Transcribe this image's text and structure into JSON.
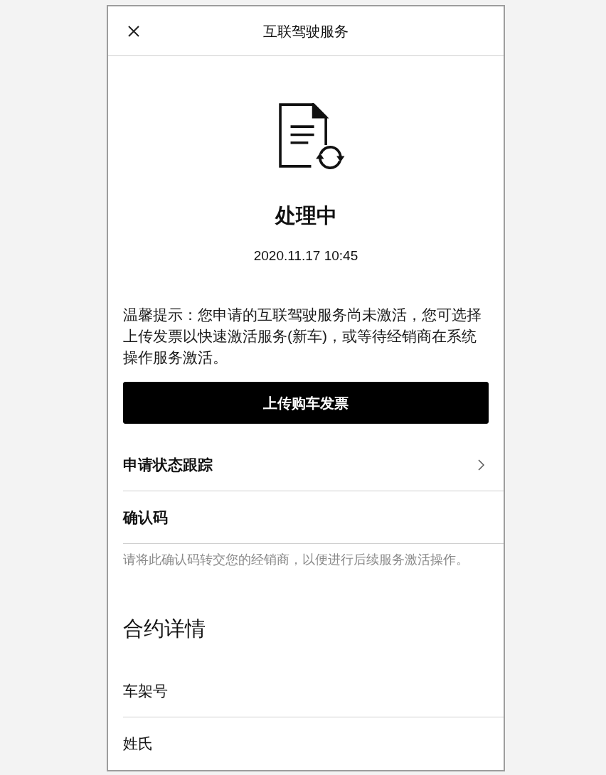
{
  "header": {
    "title": "互联驾驶服务"
  },
  "status": {
    "title": "处理中",
    "timestamp": "2020.11.17 10:45",
    "notice": "温馨提示：您申请的互联驾驶服务尚未激活，您可选择上传发票以快速激活服务(新车)，或等待经销商在系统操作服务激活。",
    "button": "上传购车发票"
  },
  "rows": [
    {
      "kind": "link",
      "label": "申请状态跟踪"
    },
    {
      "kind": "plain",
      "label": "确认码"
    }
  ],
  "confirmation_hint": "请将此确认码转交您的经销商，以便进行后续服务激活操作。",
  "contract": {
    "heading": "合约详情",
    "fields": [
      {
        "label": "车架号"
      },
      {
        "label": "姓氏"
      }
    ]
  }
}
